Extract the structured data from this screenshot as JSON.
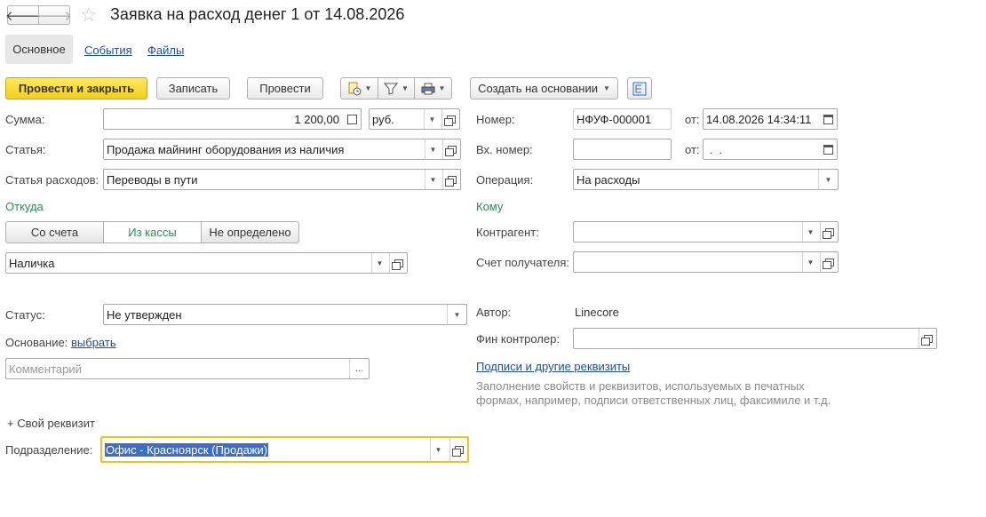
{
  "window": {
    "title": "Заявка на расход денег 1 от 14.08.2026"
  },
  "nav": {
    "back_icon": "arrow-left-icon",
    "forward_icon": "arrow-right-icon",
    "favorite_icon": "star-icon"
  },
  "tabs": [
    {
      "label": "Основное",
      "active": true
    },
    {
      "label": "События",
      "active": false
    },
    {
      "label": "Файлы",
      "active": false
    }
  ],
  "toolbar": {
    "post_and_close": "Провести и закрыть",
    "save": "Записать",
    "post": "Провести",
    "create_based_on": "Создать на основании"
  },
  "form": {
    "sum_label": "Сумма:",
    "sum_value": "1 200,00",
    "currency_value": "руб.",
    "article_label": "Статья:",
    "article_value": "Продажа майнинг оборудования из наличия",
    "expense_article_label": "Статья расходов:",
    "expense_article_value": "Переводы в пути",
    "from_label": "Откуда",
    "from_options": [
      "Со счета",
      "Из кассы",
      "Не определено"
    ],
    "from_selected": "Из кассы",
    "cash_value": "Наличка",
    "status_label": "Статус:",
    "status_value": "Не утвержден",
    "basis_label": "Основание:",
    "basis_link": "выбрать",
    "comment_placeholder": "Комментарий",
    "add_attribute": "+ Свой реквизит",
    "department_label": "Подразделение:",
    "department_value": "Офис - Красноярск (Продажи)",
    "number_label": "Номер:",
    "number_value": "НФУФ-000001",
    "date_label": "от:",
    "date_value": "14.08.2026 14:34:11",
    "in_number_label": "Вх. номер:",
    "in_number_value": "",
    "in_date_label": "от:",
    "in_date_value": " .  .",
    "operation_label": "Операция:",
    "operation_value": "На расходы",
    "to_label": "Кому",
    "counterparty_label": "Контрагент:",
    "counterparty_value": "",
    "recipient_account_label": "Счет получателя:",
    "recipient_account_value": "",
    "author_label": "Автор:",
    "author_value": "Linecore",
    "fin_controller_label": "Фин контролер:",
    "fin_controller_value": "",
    "signatures_link": "Подписи и другие реквизиты",
    "hint_text": "Заполнение свойств и реквизитов, используемых в печатных формах, например, подписи ответственных лиц, факсимиле и т.д."
  },
  "colors": {
    "primary_button": "#f3cf1c",
    "link": "#1c4e9a",
    "group_label": "#2e8b57",
    "focus_border": "#f0c419",
    "selection": "#3d6dc5"
  }
}
